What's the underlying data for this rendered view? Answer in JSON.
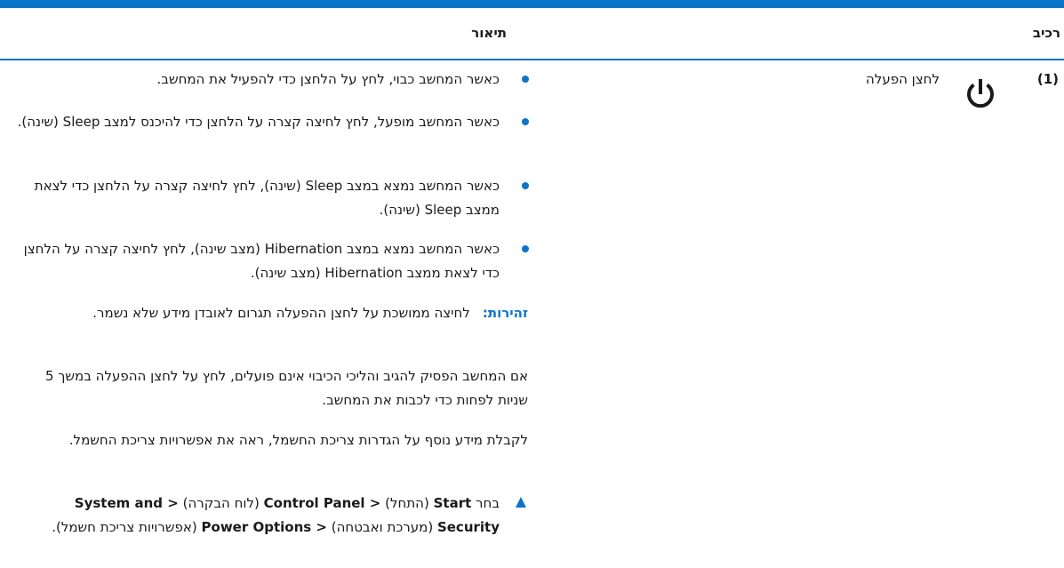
{
  "header": {
    "component": "רכיב",
    "description": "תיאור"
  },
  "row": {
    "number": "(1)",
    "icon": "power-icon",
    "component_name": "לחצן הפעלה"
  },
  "bullets": [
    "כאשר המחשב כבוי, לחץ על הלחצן כדי להפעיל את המחשב.",
    "כאשר המחשב מופעל, לחץ לחיצה קצרה על הלחצן כדי להיכנס למצב Sleep (שינה).",
    "כאשר המחשב נמצא במצב Sleep (שינה), לחץ לחיצה קצרה על הלחצן כדי לצאת ממצב Sleep (שינה).",
    "כאשר המחשב נמצא במצב Hibernation (מצב שינה), לחץ לחיצה קצרה על הלחצן כדי לצאת ממצב Hibernation (מצב שינה)."
  ],
  "caution": {
    "label": "זהירות:",
    "text": "לחיצה ממושכת על לחצן ההפעלה תגרום לאובדן מידע שלא נשמר."
  },
  "paragraphs": [
    "אם המחשב הפסיק להגיב והליכי הכיבוי אינם פועלים, לחץ על לחצן ההפעלה במשך 5 שניות לפחות כדי לכבות את המחשב.",
    "לקבלת מידע נוסף על הגדרות צריכת החשמל, ראה את אפשרויות צריכת החשמל."
  ],
  "step": {
    "p1": "בחר ",
    "b1": "Start",
    "p2": " (התחל) ",
    "b2": "< Control Panel",
    "p3": " (לוח הבקרה) ",
    "b3": "< System and Security",
    "p4": " (מערכת ואבטחה) ",
    "b4": "< Power Options",
    "p5": " (אפשרויות צריכת חשמל)."
  },
  "colors": {
    "accent": "#0b74c8",
    "text": "#1a1a1a"
  }
}
